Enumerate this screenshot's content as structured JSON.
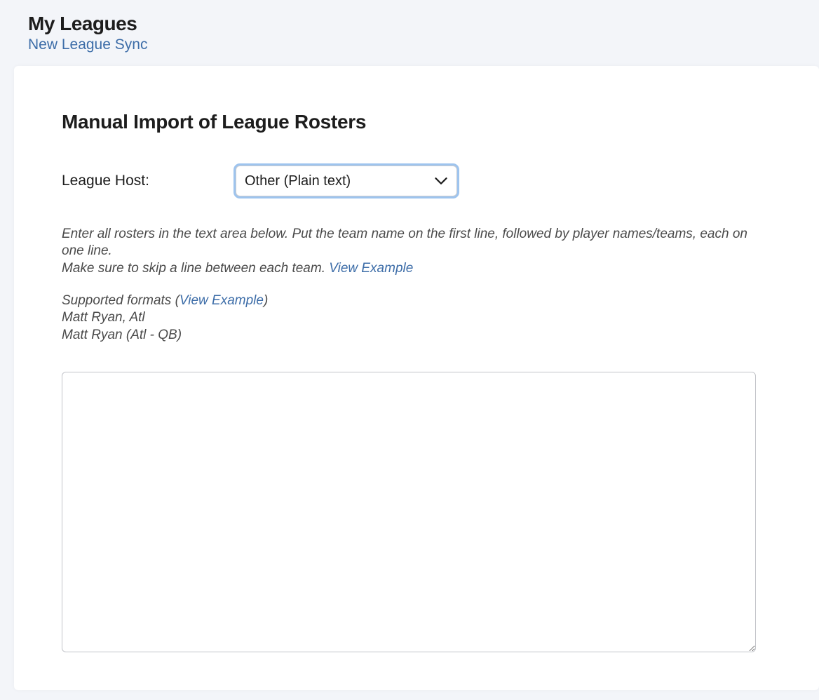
{
  "header": {
    "title": "My Leagues",
    "subtitle_link": "New League Sync"
  },
  "card": {
    "heading": "Manual Import of League Rosters",
    "host_label": "League Host:",
    "host_value": "Other (Plain text)",
    "instructions": {
      "line1": "Enter all rosters in the text area below. Put the team name on the first line, followed by player names/teams, each on one line.",
      "line2_prefix": "Make sure to skip a line between each team. ",
      "line2_link": "View Example",
      "formats_prefix": "Supported formats (",
      "formats_link": "View Example",
      "formats_suffix": ")",
      "format_example_1": "Matt Ryan, Atl",
      "format_example_2": "Matt Ryan (Atl - QB)"
    },
    "textarea_value": ""
  }
}
